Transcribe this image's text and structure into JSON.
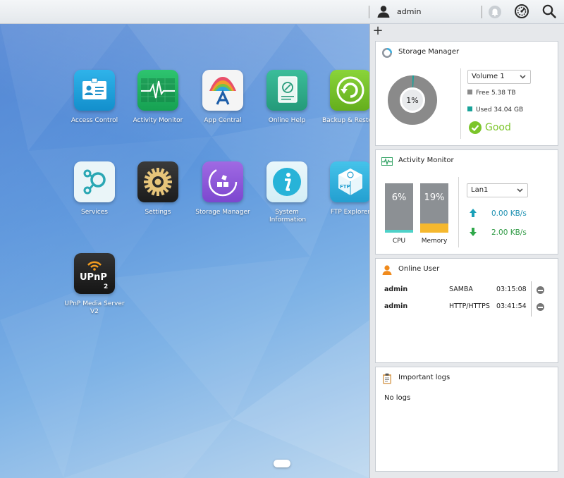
{
  "topbar": {
    "username": "admin",
    "icons": [
      "user-icon",
      "bell-icon",
      "gauge-icon",
      "search-icon"
    ]
  },
  "desktop": {
    "apps": [
      {
        "label": "Access Control",
        "icon": "id-card-icon",
        "color": "#1e9fd9"
      },
      {
        "label": "Activity Monitor",
        "icon": "heartbeat-icon",
        "color": "#20b260"
      },
      {
        "label": "App Central",
        "icon": "app-central-icon",
        "color": "#f4f4f4"
      },
      {
        "label": "Online Help",
        "icon": "help-book-icon",
        "color": "#2fae8c"
      },
      {
        "label": "Backup & Restore",
        "icon": "backup-icon",
        "color": "#7cc52b"
      },
      {
        "label": "Services",
        "icon": "services-icon",
        "color": "#e8f3f6"
      },
      {
        "label": "Settings",
        "icon": "gear-icon",
        "color": "#2b2b2b"
      },
      {
        "label": "Storage Manager",
        "icon": "storage-manager-icon",
        "color": "#8e58d8"
      },
      {
        "label": "System Information",
        "icon": "info-icon",
        "color": "#27b3d8"
      },
      {
        "label": "FTP Explorer",
        "icon": "ftp-icon",
        "color": "#35b6e0"
      },
      {
        "label": "UPnP Media Server V2",
        "icon": "upnp-icon",
        "color": "#222222"
      }
    ]
  },
  "panel": {
    "add_label": "+",
    "storage": {
      "title": "Storage Manager",
      "percent_label": "1%",
      "used_fraction": 0.01,
      "volume": "Volume 1",
      "free": "Free 5.38 TB",
      "used": "Used 34.04 GB",
      "status": "Good",
      "colors": {
        "free": "#8a8a8a",
        "used": "#19a39a",
        "good": "#7cc52b"
      }
    },
    "activity": {
      "title": "Activity Monitor",
      "cpu_label": "CPU",
      "cpu_value": "6%",
      "cpu_fraction": 0.06,
      "mem_label": "Memory",
      "mem_value": "19%",
      "mem_fraction": 0.19,
      "lan": "Lan1",
      "upload": "0.00 KB/s",
      "download": "2.00 KB/s",
      "colors": {
        "cpu": "#4ed1c8",
        "mem": "#f5b82e",
        "bar": "#8c9094",
        "up": "#1aa0b8",
        "down": "#2fa84a"
      }
    },
    "online_user": {
      "title": "Online User",
      "users": [
        {
          "name": "admin",
          "service": "SAMBA",
          "time": "03:15:08"
        },
        {
          "name": "admin",
          "service": "HTTP/HTTPS",
          "time": "03:41:54"
        }
      ]
    },
    "logs": {
      "title": "Important logs",
      "empty": "No logs"
    }
  }
}
